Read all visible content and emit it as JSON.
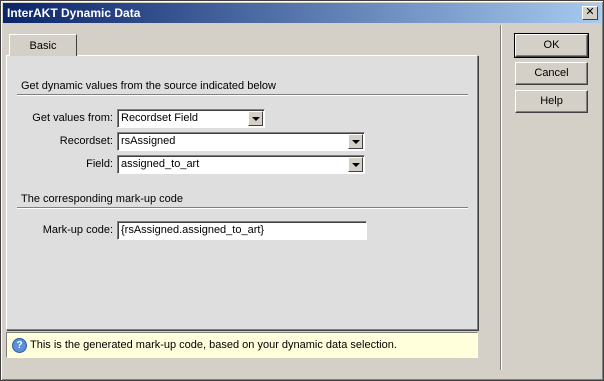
{
  "window": {
    "title": "InterAKT Dynamic Data"
  },
  "tabs": [
    {
      "label": "Basic",
      "active": true
    }
  ],
  "section1": {
    "title": "Get dynamic values from the source indicated below",
    "get_values_from": {
      "label": "Get values from:",
      "value": "Recordset Field"
    },
    "recordset": {
      "label": "Recordset:",
      "value": "rsAssigned"
    },
    "field": {
      "label": "Field:",
      "value": "assigned_to_art"
    }
  },
  "section2": {
    "title": "The corresponding mark-up code",
    "markup_code": {
      "label": "Mark-up code:",
      "value": "{rsAssigned.assigned_to_art}"
    }
  },
  "info": {
    "text": "This is the generated mark-up code, based on your dynamic data selection."
  },
  "buttons": {
    "ok": "OK",
    "cancel": "Cancel",
    "help": "Help"
  },
  "colors": {
    "title_start": "#0a246a",
    "title_end": "#a6caf0",
    "info_bg": "#ffffdc",
    "face": "#d4d0c8"
  }
}
